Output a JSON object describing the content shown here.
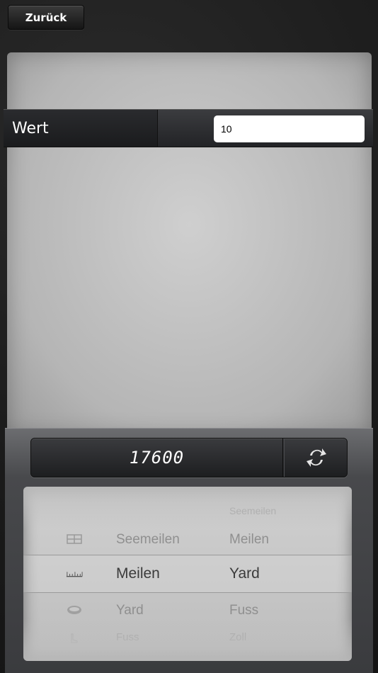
{
  "nav": {
    "back_label": "Zurück"
  },
  "input_row": {
    "label": "Wert",
    "value": "10"
  },
  "result": {
    "value": "17600"
  },
  "picker": {
    "from_units": [
      "Seemeilen",
      "Meilen",
      "Yard",
      "Fuss"
    ],
    "to_units": [
      "Seemeilen",
      "Meilen",
      "Yard",
      "Fuss",
      "Zoll"
    ],
    "selected_from": "Meilen",
    "selected_to": "Yard",
    "icons": [
      "grid-icon",
      "ruler-icon",
      "tape-measure-icon",
      "foot-icon"
    ]
  }
}
